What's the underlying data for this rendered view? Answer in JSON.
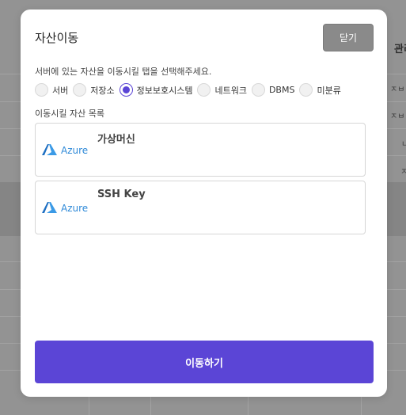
{
  "background": {
    "column_header": "관리",
    "cells": [
      "ㅈㅂ",
      "ㅈㅂ",
      "ㄴ",
      "ㅈ"
    ]
  },
  "modal": {
    "title": "자산이동",
    "close_label": "닫기",
    "description": "서버에 있는 자산을 이동시킬 탭을 선택해주세요.",
    "tabs": [
      {
        "label": "서버",
        "selected": false
      },
      {
        "label": "저장소",
        "selected": false
      },
      {
        "label": "정보보호시스템",
        "selected": true
      },
      {
        "label": "네트워크",
        "selected": false
      },
      {
        "label": "DBMS",
        "selected": false
      },
      {
        "label": "미분류",
        "selected": false
      }
    ],
    "list_title": "이동시킬 자산 목록",
    "assets": [
      {
        "provider": "Azure",
        "name": "가상머신",
        "icon": "azure-logo-icon"
      },
      {
        "provider": "Azure",
        "name": "SSH Key",
        "icon": "azure-logo-icon"
      }
    ],
    "submit_label": "이동하기"
  },
  "colors": {
    "accent": "#5b45d6",
    "close_button": "#8a8a8a",
    "azure": "#2f8ad8"
  }
}
